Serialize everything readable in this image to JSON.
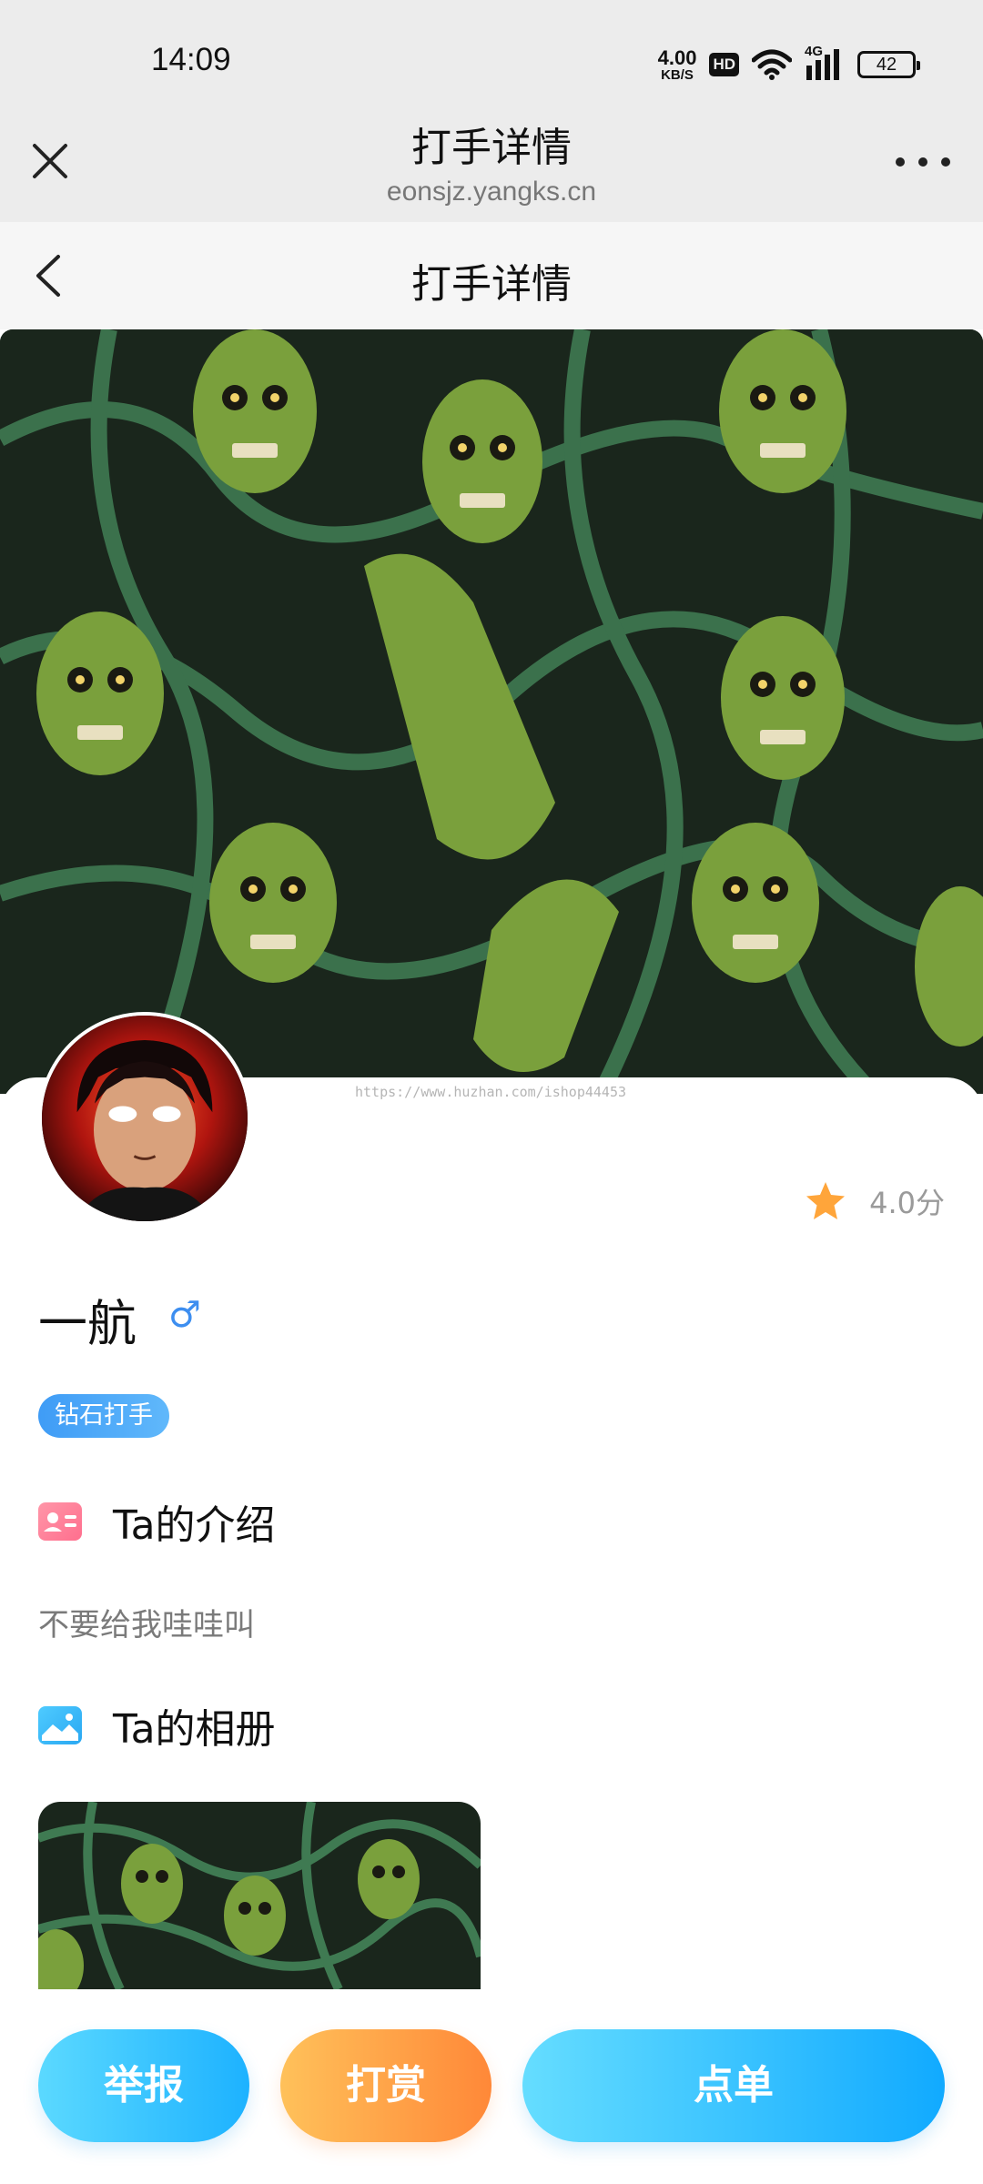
{
  "status_bar": {
    "time": "14:09",
    "net_speed_value": "4.00",
    "net_speed_unit": "KB/S",
    "hd_label": "HD",
    "signal_label": "4G",
    "battery": "42",
    "icons": [
      "wifi-icon",
      "signal-icon",
      "battery-icon"
    ]
  },
  "browser": {
    "title": "打手详情",
    "url": "eonsjz.yangks.cn",
    "close_icon": "close-icon",
    "more_icon": "more-icon"
  },
  "header": {
    "title": "打手详情",
    "back_icon": "chevron-left-icon"
  },
  "watermark": "https://www.huzhan.com/ishop44453",
  "profile": {
    "name": "一航",
    "gender_symbol": "♂",
    "rating": "4.0分",
    "level_badge": "钻石打手"
  },
  "intro": {
    "heading": "Ta的介绍",
    "text": "不要给我哇哇叫"
  },
  "album": {
    "heading": "Ta的相册"
  },
  "actions": {
    "report": "举报",
    "reward": "打赏",
    "order": "点单"
  },
  "colors": {
    "accent_blue": "#1db2ff",
    "accent_orange": "#ff8838",
    "star": "#ffa53a",
    "cover_bg": "#1d2a1f",
    "cover_fg": "#6a9a3a"
  }
}
